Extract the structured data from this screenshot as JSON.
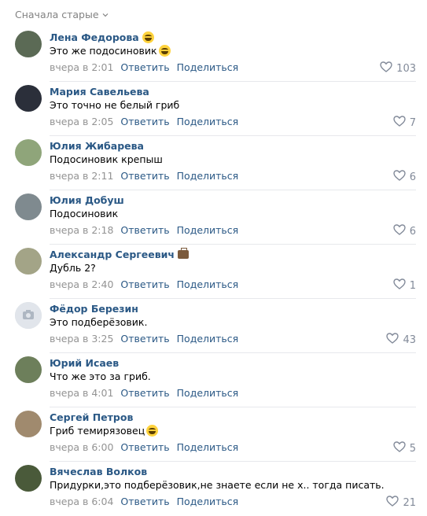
{
  "sort": {
    "label": "Сначала старые"
  },
  "comments": [
    {
      "author": "Лена Федорова",
      "badge": "smile-emoji",
      "text": "Это же подосиновик",
      "text_emoji": "grin-emoji",
      "time": "вчера в 2:01",
      "reply": "Ответить",
      "share": "Поделиться",
      "likes": "103",
      "avatar_color": "#5b6a55"
    },
    {
      "author": "Мария Савельева",
      "text": "Это точно не белый гриб",
      "time": "вчера в 2:05",
      "reply": "Ответить",
      "share": "Поделиться",
      "likes": "7",
      "avatar_color": "#2b2f3a"
    },
    {
      "author": "Юлия Жибарева",
      "text": "Подосиновик крепыш",
      "time": "вчера в 2:11",
      "reply": "Ответить",
      "share": "Поделиться",
      "likes": "6",
      "avatar_color": "#8fa57a"
    },
    {
      "author": "Юлия Добуш",
      "text": "Подосиновик",
      "time": "вчера в 2:18",
      "reply": "Ответить",
      "share": "Поделиться",
      "likes": "6",
      "avatar_color": "#7f8a8f"
    },
    {
      "author": "Александр Сергеевич",
      "badge": "briefcase-emoji",
      "text": "Дубль 2?",
      "time": "вчера в 2:40",
      "reply": "Ответить",
      "share": "Поделиться",
      "likes": "1",
      "avatar_color": "#a3a487"
    },
    {
      "author": "Фёдор Березин",
      "text": "Это подберёзовик.",
      "time": "вчера в 3:25",
      "reply": "Ответить",
      "share": "Поделиться",
      "likes": "43",
      "avatar_color": "#d3d9de",
      "avatar_placeholder": true
    },
    {
      "author": "Юрий Исаев",
      "text": "Что же это за гриб.",
      "time": "вчера в 4:01",
      "reply": "Ответить",
      "share": "Поделиться",
      "likes": "",
      "avatar_color": "#6d7f5b"
    },
    {
      "author": "Сергей Петров",
      "text": "Гриб темирязовец",
      "text_emoji": "laugh-emoji",
      "time": "вчера в 6:00",
      "reply": "Ответить",
      "share": "Поделиться",
      "likes": "5",
      "avatar_color": "#a08a6e"
    },
    {
      "author": "Вячеслав Волков",
      "text": "Придурки,это подберёзовик,не знаете если не х.. тогда писать.",
      "time": "вчера в 6:04",
      "reply": "Ответить",
      "share": "Поделиться",
      "likes": "21",
      "avatar_color": "#4a5a3a"
    }
  ],
  "colors": {
    "link": "#2a5885",
    "meta": "#939393",
    "like": "#828a99",
    "separator": "#e7e8ec"
  }
}
